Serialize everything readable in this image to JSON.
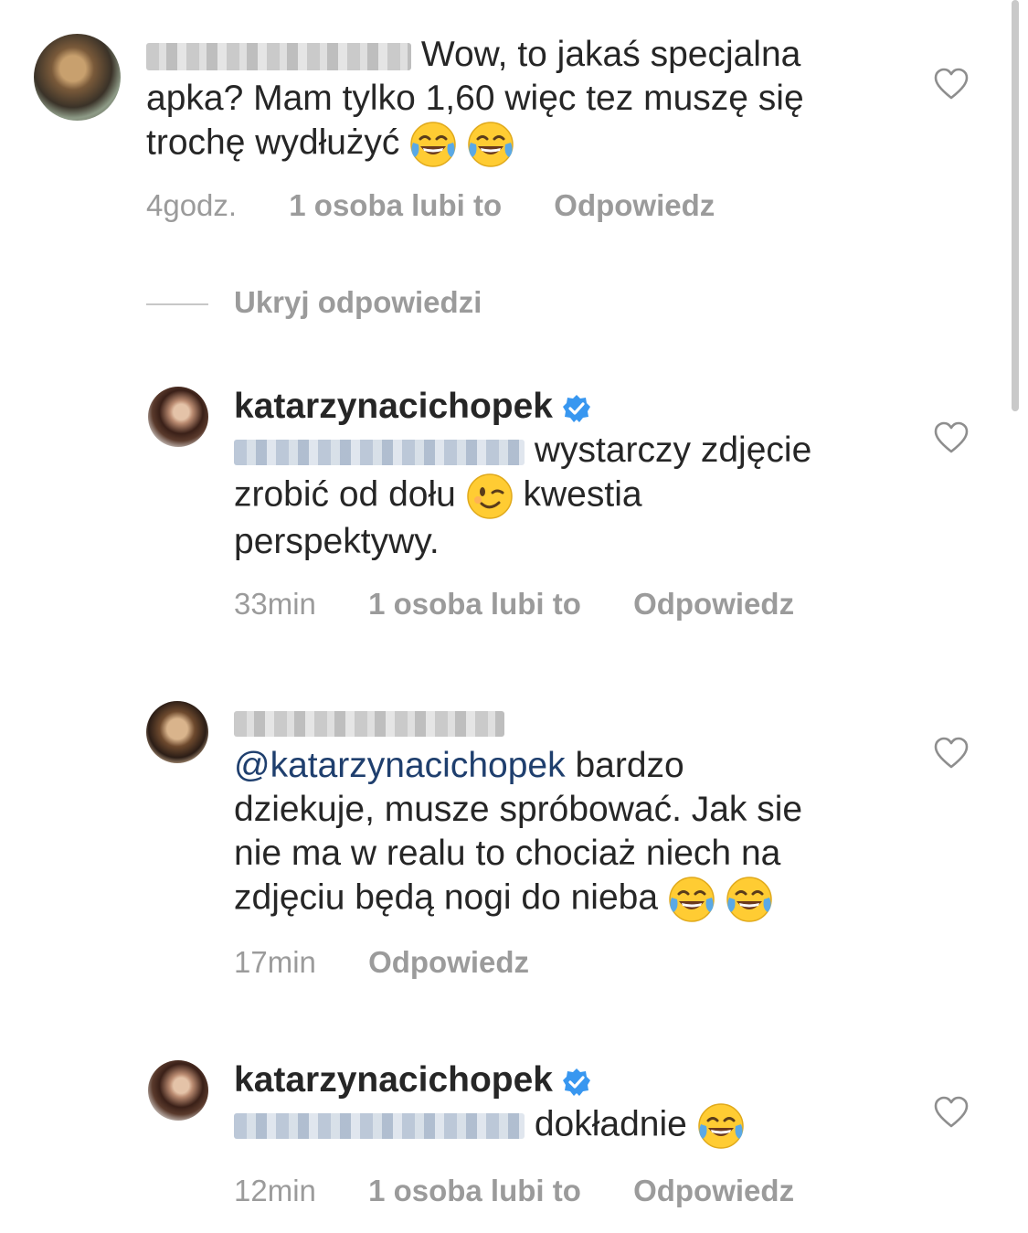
{
  "comments": [
    {
      "username_visible": "",
      "text": "Wow, to jakaś specjalna apka? Mam tylko 1,60 więc tez muszę się trochę wydłużyć",
      "line1": "Wow, to jakaś specjalna",
      "line2": "apka? Mam tylko 1,60 więc tez muszę się",
      "line3": "trochę wydłużyć",
      "time": "4godz.",
      "likes": "1 osoba lubi to",
      "reply": "Odpowiedz",
      "emoji": [
        "face-with-tears-of-joy-icon",
        "face-with-tears-of-joy-icon"
      ]
    }
  ],
  "hide_replies_label": "Ukryj odpowiedzi",
  "replies": [
    {
      "username": "katarzynacichopek",
      "verified": true,
      "line1": "wystarczy zdjęcie",
      "line2a": "zrobić od dołu",
      "line2b": "kwestia",
      "line3": "perspektywy.",
      "time": "33min",
      "likes": "1 osoba lubi to",
      "reply": "Odpowiedz"
    },
    {
      "mention": "@katarzynacichopek",
      "line1": "bardzo",
      "line2": "dziekuje, musze spróbować. Jak sie",
      "line3": "nie ma w realu to chociaż niech na",
      "line4": "zdjęciu będą nogi do nieba",
      "time": "17min",
      "reply": "Odpowiedz"
    },
    {
      "username": "katarzynacichopek",
      "verified": true,
      "text": "dokładnie",
      "time": "12min",
      "likes": "1 osoba lubi to",
      "reply": "Odpowiedz"
    }
  ],
  "colors": {
    "text": "#262626",
    "meta": "#9b9b9b",
    "mention": "#1f3f6e",
    "verified": "#3897f0",
    "emoji": "#ffcc33"
  }
}
